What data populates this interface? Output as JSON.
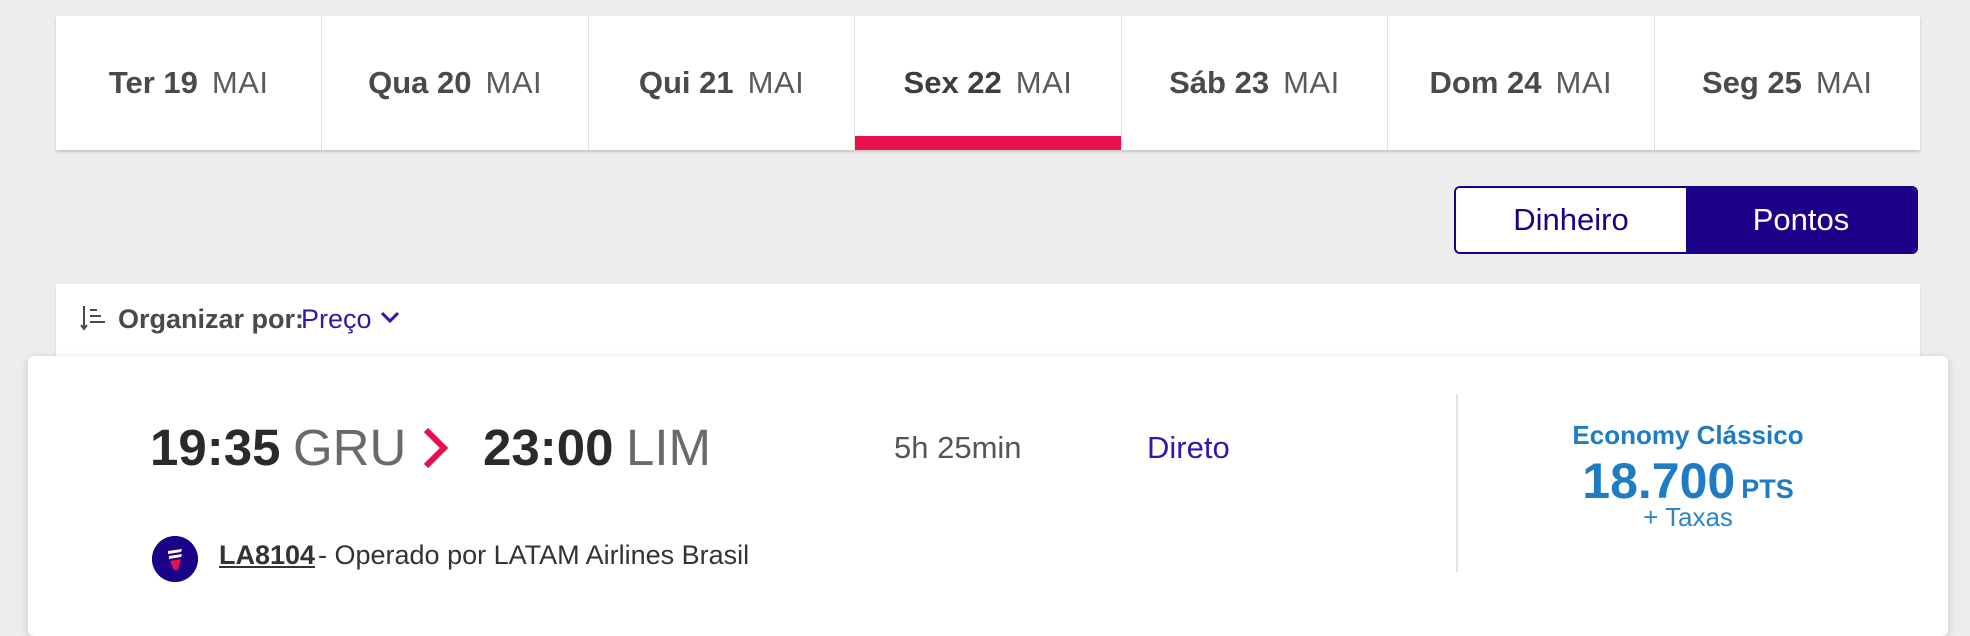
{
  "date_tabs": [
    {
      "day": "Ter 19",
      "month": "MAI",
      "selected": false
    },
    {
      "day": "Qua 20",
      "month": "MAI",
      "selected": false
    },
    {
      "day": "Qui 21",
      "month": "MAI",
      "selected": false
    },
    {
      "day": "Sex 22",
      "month": "MAI",
      "selected": true
    },
    {
      "day": "Sáb 23",
      "month": "MAI",
      "selected": false
    },
    {
      "day": "Dom 24",
      "month": "MAI",
      "selected": false
    },
    {
      "day": "Seg 25",
      "month": "MAI",
      "selected": false
    }
  ],
  "currency_toggle": {
    "money_label": "Dinheiro",
    "points_label": "Pontos",
    "selected": "Pontos"
  },
  "sort": {
    "label": "Organizar por:",
    "value": "Preço"
  },
  "flight": {
    "departure_time": "19:35",
    "departure_airport": "GRU",
    "arrival_time": "23:00",
    "arrival_airport": "LIM",
    "duration": "5h 25min",
    "stops": "Direto",
    "fare_class": "Economy Clássico",
    "price": "18.700",
    "price_unit": "PTS",
    "taxes": "+ Taxas",
    "flight_number": "LA8104",
    "operator": "- Operado por LATAM Airlines Brasil"
  },
  "colors": {
    "accent_pink": "#e8114b",
    "brand_navy": "#1b0088",
    "price_blue": "#1f7cc2"
  }
}
